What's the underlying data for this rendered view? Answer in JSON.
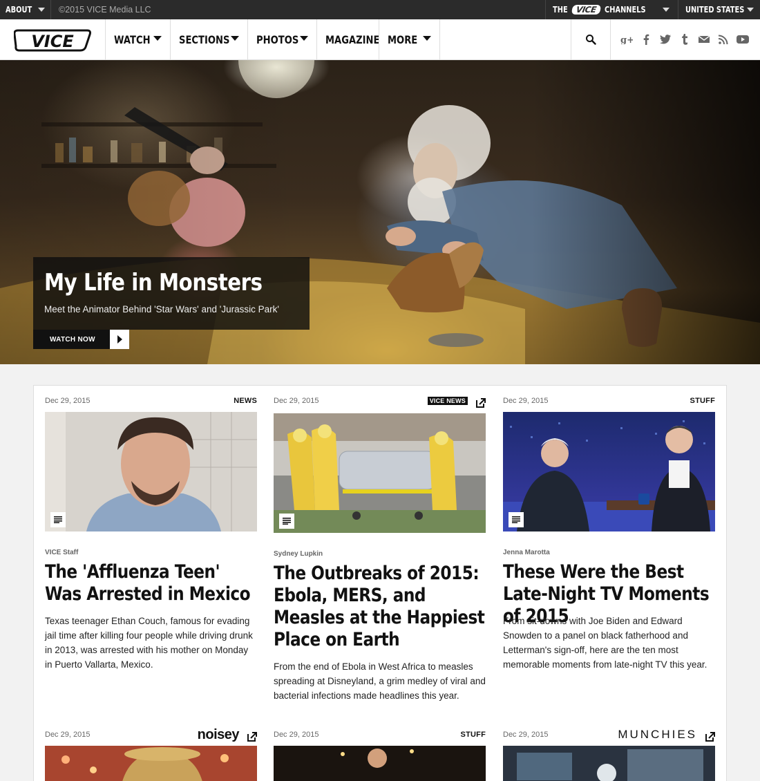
{
  "topbar": {
    "about": "ABOUT",
    "copyright": "©2015 VICE Media LLC",
    "the": "THE",
    "mini_logo": "VICE",
    "channels": "CHANNELS",
    "country": "UNITED STATES"
  },
  "nav": {
    "logo": "VICE",
    "items": [
      {
        "label": "WATCH",
        "dropdown": true
      },
      {
        "label": "SECTIONS",
        "dropdown": true
      },
      {
        "label": "PHOTOS",
        "dropdown": true
      },
      {
        "label": "MAGAZINE",
        "dropdown": false
      },
      {
        "label": "MORE",
        "dropdown": true
      }
    ],
    "social_icons": [
      "google-plus-icon",
      "facebook-icon",
      "twitter-icon",
      "tumblr-icon",
      "mail-icon",
      "rss-icon",
      "youtube-icon"
    ]
  },
  "hero": {
    "title": "My Life in Monsters",
    "subtitle": "Meet the Animator Behind 'Star Wars' and 'Jurassic Park'",
    "cta": "WATCH NOW"
  },
  "cards": [
    {
      "date": "Dec 29, 2015",
      "tag": "NEWS",
      "author": "VICE Staff",
      "title": "The 'Affluenza Teen' Was Arrested in Mexico",
      "dek": "Texas teenager Ethan Couch, famous for evading jail time after killing four people while driving drunk in 2013, was arrested with his mother on Monday in Puerto Vallarta, Mexico."
    },
    {
      "date": "Dec 29, 2015",
      "tag": "VICE NEWS",
      "author": "Sydney Lupkin",
      "title": "The Outbreaks of 2015: Ebola, MERS, and Measles at the Happiest Place on Earth",
      "dek": "From the end of Ebola in West Africa to measles spreading at Disneyland, a grim medley of viral and bacterial infections made headlines this year."
    },
    {
      "date": "Dec 29, 2015",
      "tag": "STUFF",
      "author": "Jenna Marotta",
      "title": "These Were the Best Late-Night TV Moments of 2015",
      "dek": "From sit-downs with Joe Biden and Edward Snowden to a panel on black fatherhood and Letterman's sign-off, here are the ten most memorable moments from late-night TV this year."
    },
    {
      "date": "Dec 29, 2015",
      "tag": "noisey"
    },
    {
      "date": "Dec 29, 2015",
      "tag": "STUFF"
    },
    {
      "date": "Dec 29, 2015",
      "tag": "MUNCHIES"
    }
  ]
}
